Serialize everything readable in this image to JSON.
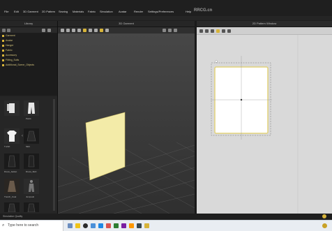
{
  "menubar": {
    "items": [
      "File",
      "Edit",
      "3D Garment",
      "2D Pattern",
      "Sewing",
      "Materials",
      "Fabric",
      "Simulation",
      "Avatar",
      "Render",
      "Settings/Preferences",
      "Help"
    ],
    "watermark": "RRCG.cn"
  },
  "library": {
    "title": "Library",
    "tree": [
      "Garment",
      "Avatar",
      "Hanger",
      "Fabric",
      "Accessory",
      "Fitting_Suits",
      "Additional_Scene_Objects"
    ],
    "thumbs": [
      "",
      "Pants",
      "T-shirt",
      "Skirt",
      "Dress_Jacket",
      "Dress_Skirt",
      "Trench_Coat",
      "Jumpsuit",
      "Skirt_Jacket",
      ""
    ]
  },
  "viewport3d": {
    "title": "3D Garment"
  },
  "viewport2d": {
    "title": "2D Pattern Window"
  },
  "status": {
    "text": "Simulation Quality"
  },
  "taskbar": {
    "search_placeholder": "Type here to search"
  },
  "colors": {
    "panel_fill": "#f3eba8",
    "accent": "#d7b43a"
  }
}
